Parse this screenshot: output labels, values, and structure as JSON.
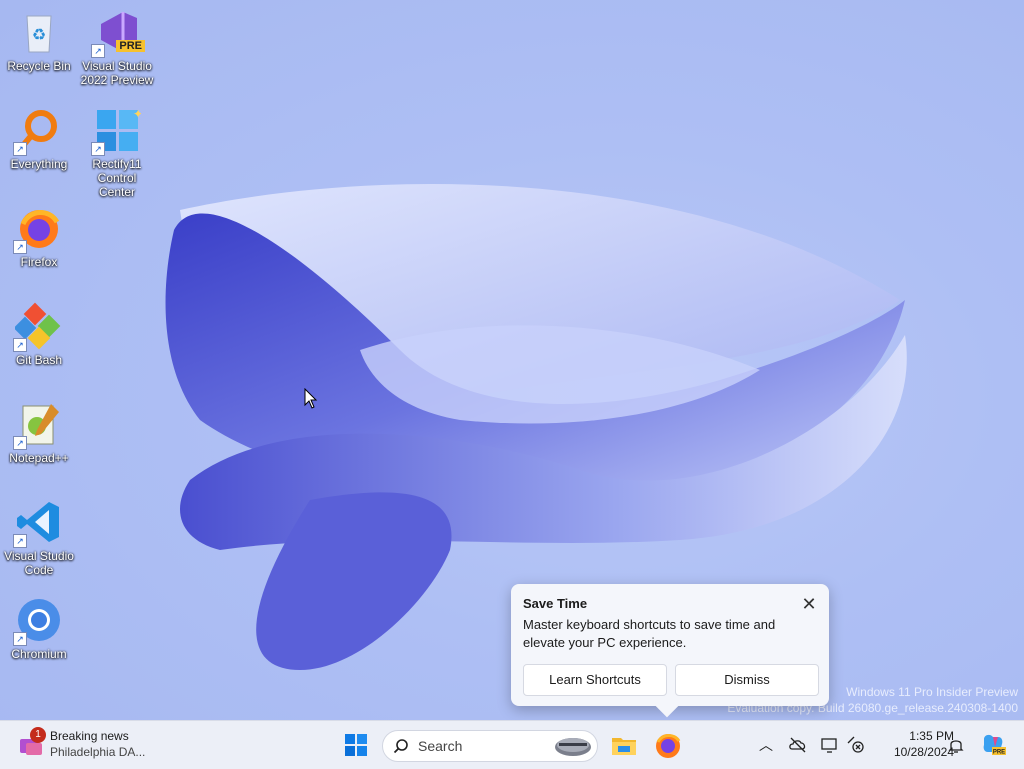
{
  "desktop": {
    "icons": [
      {
        "label": "Recycle Bin",
        "icon": "recycle-bin-icon"
      },
      {
        "label": "Visual Studio 2022 Preview",
        "badge": "PRE",
        "icon": "visual-studio-icon"
      },
      {
        "label": "Everything",
        "icon": "everything-search-icon"
      },
      {
        "label": "Rectify11 Control Center",
        "icon": "rectify11-icon"
      },
      {
        "label": "Firefox",
        "icon": "firefox-icon"
      },
      {
        "label": "Git Bash",
        "icon": "git-bash-icon"
      },
      {
        "label": "Notepad++",
        "icon": "notepadpp-icon"
      },
      {
        "label": "Visual Studio Code",
        "icon": "vscode-icon"
      },
      {
        "label": "Chromium",
        "icon": "chromium-icon"
      }
    ],
    "watermark": {
      "line1": "Windows 11 Pro Insider Preview",
      "line2": "Evaluation copy. Build 26080.ge_release.240308-1400"
    }
  },
  "toast": {
    "title": "Save Time",
    "body": "Master keyboard shortcuts to save time and elevate your PC experience.",
    "close_icon": "close-icon",
    "primary_label": "Learn Shortcuts",
    "secondary_label": "Dismiss"
  },
  "taskbar": {
    "news": {
      "badge": "1",
      "title": "Breaking news",
      "subtitle": "Philadelphia DA..."
    },
    "search": {
      "placeholder": "Search"
    },
    "apps": [
      "start-icon",
      "file-explorer-icon",
      "firefox-icon"
    ],
    "tray": [
      "chevron-up-icon",
      "onedrive-offline-icon",
      "display-icon",
      "network-error-icon"
    ],
    "clock": {
      "time": "1:35 PM",
      "date": "10/28/2024"
    },
    "colors": {
      "accent": "#0067c0",
      "badge": "#c42b1c"
    }
  }
}
